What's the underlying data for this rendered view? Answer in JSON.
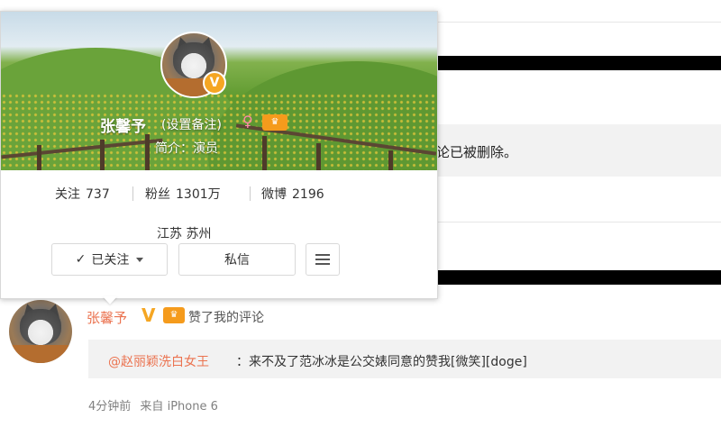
{
  "background": {
    "deleted_notice": "论已被删除。"
  },
  "profile_card": {
    "name": "张馨予",
    "remark_link": "(设置备注)",
    "gender_symbol": "♀",
    "verified_badge": "V",
    "intro": "简介：演员",
    "stats": [
      {
        "label": "关注",
        "value": "737"
      },
      {
        "label": "粉丝",
        "value": "1301万"
      },
      {
        "label": "微博",
        "value": "2196"
      }
    ],
    "location": "江苏 苏州",
    "buttons": {
      "follow": "已关注",
      "message": "私信"
    },
    "colors": {
      "accent": "#f5a623",
      "vip": "#f59b1c"
    }
  },
  "feed_item": {
    "user_name": "张馨予",
    "verified_badge": "V",
    "action": "赞了我的评论",
    "quote_mention": "@赵丽颖洗白女王",
    "quote_text": "：来不及了范冰冰是公交婊同意的赞我[微笑][doge]",
    "time": "4分钟前",
    "source_prefix": "来自",
    "source_device": "iPhone 6",
    "colors": {
      "name": "#eb7350",
      "meta": "#808080"
    }
  }
}
